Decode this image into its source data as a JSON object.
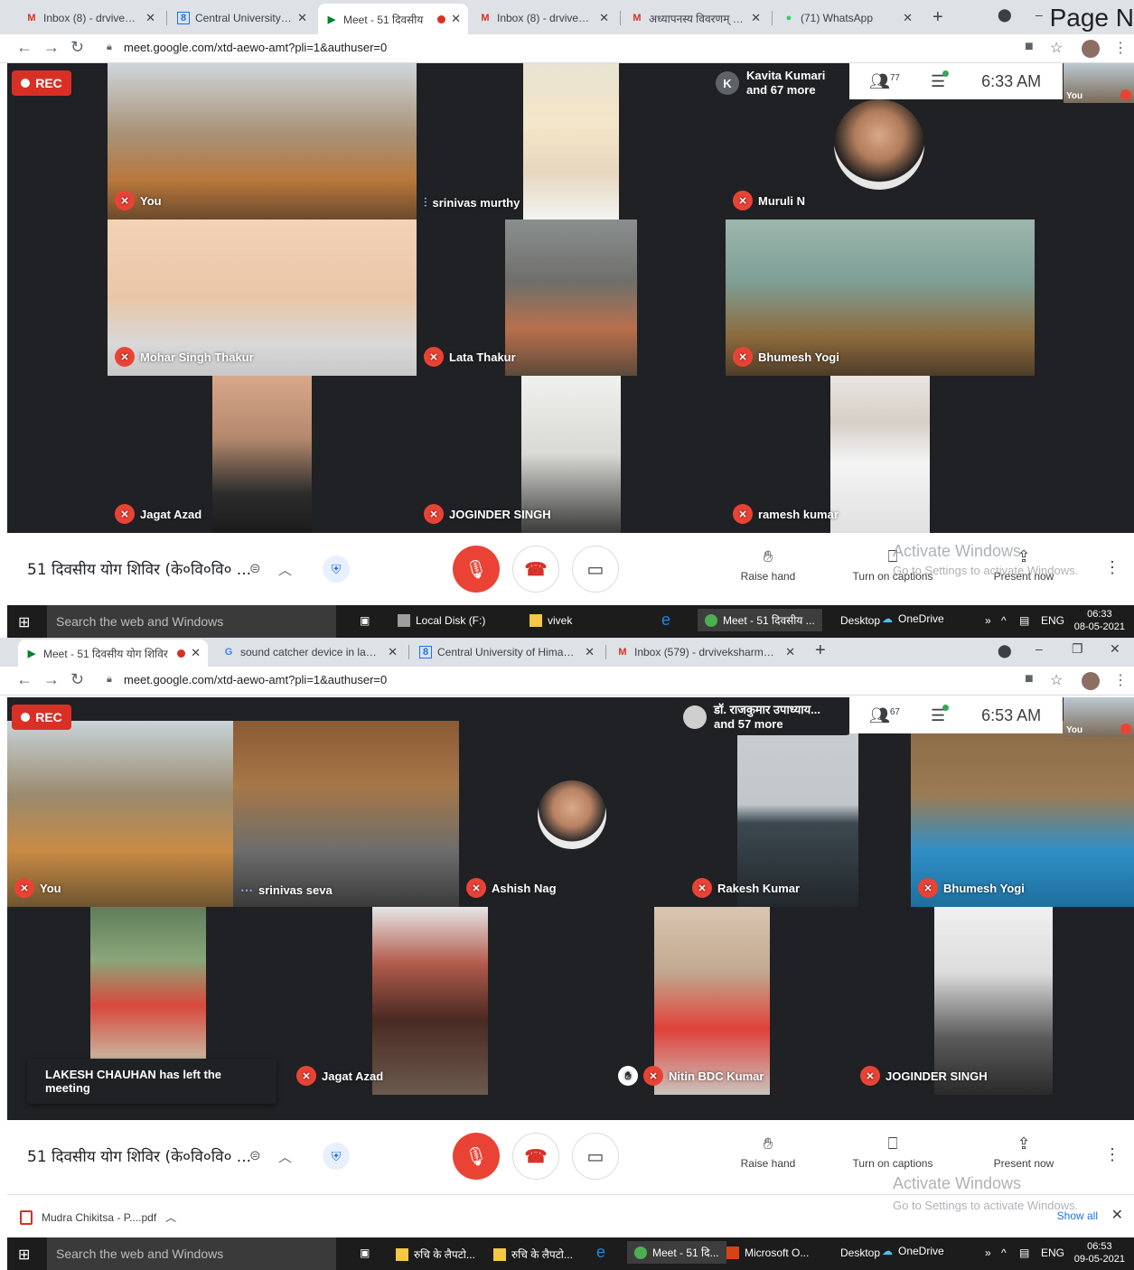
{
  "page_number_label": "Page N",
  "shot1": {
    "tabs": [
      {
        "icon": "gmail-icon",
        "title": "Inbox (8) - drvivekshar"
      },
      {
        "icon": "cuhp-icon",
        "title": "Central University of H"
      },
      {
        "icon": "meet-icon",
        "title": "Meet - 51 दिवसीय"
      },
      {
        "icon": "gmail-icon",
        "title": "Inbox (8) - drvivekshar"
      },
      {
        "icon": "gmail-icon",
        "title": "अध्यापनस्य विवरणम् - dr"
      },
      {
        "icon": "whatsapp-icon",
        "title": "(71) WhatsApp"
      }
    ],
    "url": "meet.google.com/xtd-aewo-amt?pli=1&authuser=0",
    "rec": "REC",
    "presenter_initial": "K",
    "presenter_line1": "Kavita Kumari",
    "presenter_line2": "and 67 more",
    "people_count": "77",
    "time": "6:33 AM",
    "self_label": "You",
    "participants": [
      "You",
      "srinivas murthy",
      "Muruli N",
      "Mohar Singh Thakur",
      "Lata Thakur",
      "Bhumesh Yogi",
      "Jagat Azad",
      "JOGINDER SINGH",
      "ramesh kumar"
    ],
    "meeting_title": "51 दिवसीय योग शिविर (के०वि०वि० ...",
    "raise_hand": "Raise hand",
    "captions": "Turn on captions",
    "present": "Present now",
    "watermark1": "Activate Windows",
    "watermark2": "Go to Settings to activate Windows.",
    "taskbar": {
      "search": "Search the web and Windows",
      "items": [
        "Local Disk (F:)",
        "vivek",
        "Meet - 51 दिवसीय ...",
        "Desktop",
        "OneDrive"
      ],
      "lang": "ENG",
      "time": "06:33",
      "date": "08-05-2021"
    }
  },
  "shot2": {
    "tabs": [
      {
        "icon": "meet-icon",
        "title": "Meet - 51 दिवसीय योग शिविर"
      },
      {
        "icon": "google-icon",
        "title": "sound catcher device in laptop -"
      },
      {
        "icon": "cuhp-icon",
        "title": "Central University of Himachal Pr"
      },
      {
        "icon": "gmail-icon",
        "title": "Inbox (579) - drviveksharma.skt@"
      }
    ],
    "url": "meet.google.com/xtd-aewo-amt?pli=1&authuser=0",
    "rec": "REC",
    "presenter_line1": "डॉ. राजकुमार उपाध्याय...",
    "presenter_line2": "and 57 more",
    "people_count": "67",
    "time": "6:53 AM",
    "self_label": "You",
    "participants": [
      "You",
      "srinivas seva",
      "Ashish Nag",
      "Rakesh Kumar",
      "Bhumesh Yogi",
      "Jagat Azad",
      "Nitin BDC Kumar",
      "JOGINDER SINGH"
    ],
    "toast": "LAKESH CHAUHAN has left the meeting",
    "meeting_title": "51 दिवसीय योग शिविर (के०वि०वि० ...",
    "raise_hand": "Raise hand",
    "captions": "Turn on captions",
    "present": "Present now",
    "watermark1": "Activate Windows",
    "watermark2": "Go to Settings to activate Windows.",
    "download": "Mudra Chikitsa - P....pdf",
    "show_all": "Show all",
    "taskbar": {
      "search": "Search the web and Windows",
      "items": [
        "रुचि के लैपटो...",
        "रुचि के लैपटो...",
        "Meet - 51 दि...",
        "Microsoft O...",
        "Desktop",
        "OneDrive"
      ],
      "lang": "ENG",
      "time": "06:53",
      "date": "09-05-2021"
    }
  },
  "colors": {
    "mute_red": "#ea4335",
    "rec_red": "#d93025",
    "meet_bg": "#202124",
    "accent_blue": "#1a73e8"
  }
}
